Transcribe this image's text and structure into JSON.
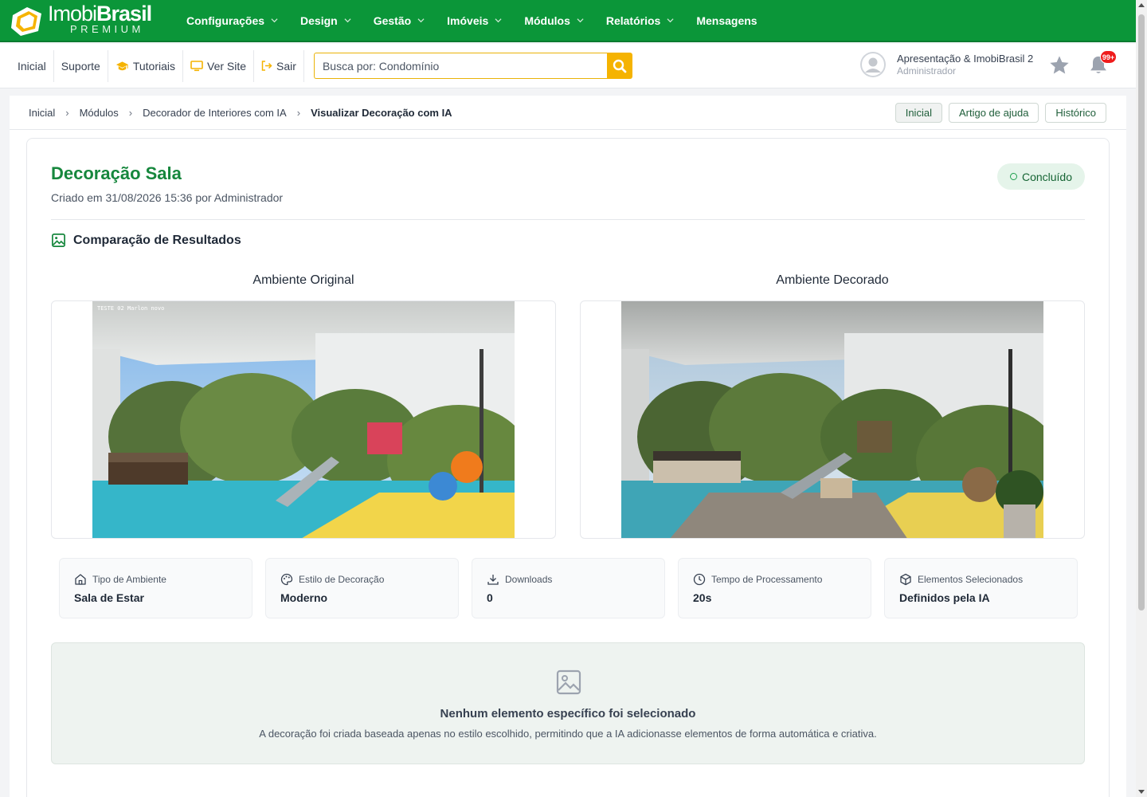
{
  "brand": {
    "name_light": "Imobi",
    "name_bold": "Brasil",
    "tier": "PREMIUM"
  },
  "nav": {
    "items": [
      {
        "label": "Configurações",
        "dropdown": true
      },
      {
        "label": "Design",
        "dropdown": true
      },
      {
        "label": "Gestão",
        "dropdown": true
      },
      {
        "label": "Imóveis",
        "dropdown": true
      },
      {
        "label": "Módulos",
        "dropdown": true
      },
      {
        "label": "Relatórios",
        "dropdown": true
      },
      {
        "label": "Mensagens",
        "dropdown": false
      }
    ]
  },
  "subbar": {
    "links": {
      "inicial": "Inicial",
      "suporte": "Suporte",
      "tutoriais": "Tutoriais",
      "ver_site": "Ver Site",
      "sair": "Sair"
    },
    "search_placeholder": "Busca por: Condomínio"
  },
  "user": {
    "name": "Apresentação & ImobiBrasil 2",
    "role": "Administrador",
    "notifications": "99+"
  },
  "breadcrumb": {
    "items": [
      "Inicial",
      "Módulos",
      "Decorador de Interiores com IA",
      "Visualizar Decoração com IA"
    ],
    "buttons": {
      "inicial": "Inicial",
      "ajuda": "Artigo de ajuda",
      "historico": "Histórico"
    }
  },
  "decoration": {
    "title": "Decoração Sala",
    "created": "Criado em 31/08/2026 15:36 por Administrador",
    "status": "Concluído"
  },
  "comparison": {
    "section_title": "Comparação de Resultados",
    "original_label": "Ambiente Original",
    "decorated_label": "Ambiente Decorado",
    "original_watermark": "TESTE 02 Marlon novo"
  },
  "stats": [
    {
      "icon": "home-icon",
      "label": "Tipo de Ambiente",
      "value": "Sala de Estar"
    },
    {
      "icon": "palette-icon",
      "label": "Estilo de Decoração",
      "value": "Moderno"
    },
    {
      "icon": "download-icon",
      "label": "Downloads",
      "value": "0"
    },
    {
      "icon": "clock-icon",
      "label": "Tempo de Processamento",
      "value": "20s"
    },
    {
      "icon": "cube-icon",
      "label": "Elementos Selecionados",
      "value": "Definidos pela IA"
    }
  ],
  "empty_state": {
    "title": "Nenhum elemento específico foi selecionado",
    "text": "A decoração foi criada baseada apenas no estilo escolhido, permitindo que a IA adicionasse elementos de forma automática e criativa."
  },
  "colors": {
    "brand_green": "#0b9639",
    "title_green": "#16873d",
    "search_yellow": "#f5b301",
    "badge_red": "#ef1c1c"
  }
}
